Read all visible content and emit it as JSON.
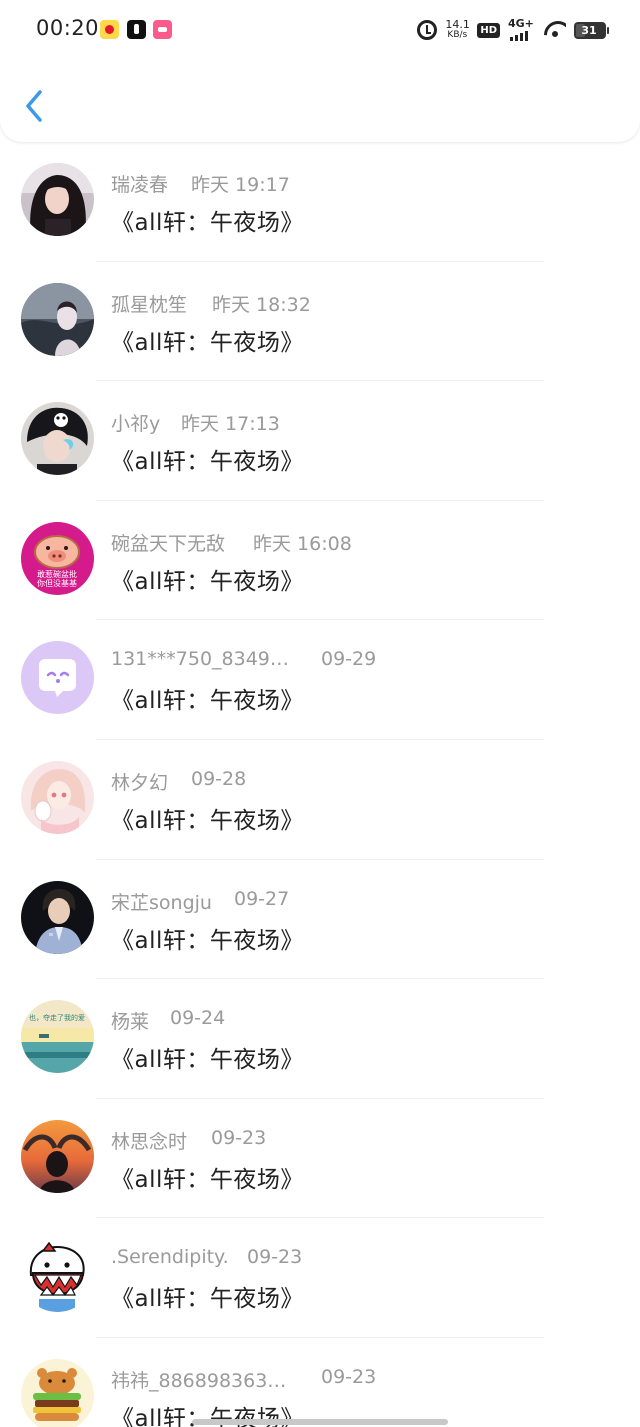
{
  "status_bar": {
    "time": "00:20",
    "speed_value": "14.1",
    "speed_unit": "KB/s",
    "hd": "HD",
    "network": "4G+",
    "battery": "31",
    "notification_icons": [
      "weibo-icon",
      "tiktok-icon",
      "lofter-icon"
    ]
  },
  "header": {
    "back_icon": "chevron-left-icon",
    "accent": "#3a9ae8"
  },
  "items": [
    {
      "name": "瑞凌春",
      "time": "昨天 19:17",
      "message": "《all轩：午夜场》"
    },
    {
      "name": "孤星枕笙",
      "time": "昨天 18:32",
      "message": "《all轩：午夜场》"
    },
    {
      "name": "小祁y",
      "time": "昨天 17:13",
      "message": "《all轩：午夜场》"
    },
    {
      "name": "碗盆天下无敌",
      "time": "昨天 16:08",
      "message": "《all轩：午夜场》"
    },
    {
      "name": "131***750_8349…",
      "time": "09-29",
      "message": "《all轩：午夜场》"
    },
    {
      "name": "林夕幻",
      "time": "09-28",
      "message": "《all轩：午夜场》"
    },
    {
      "name": "宋芷songju",
      "time": "09-27",
      "message": "《all轩：午夜场》"
    },
    {
      "name": "杨莱",
      "time": "09-24",
      "message": "《all轩：午夜场》"
    },
    {
      "name": "林思念时",
      "time": "09-23",
      "message": "《all轩：午夜场》"
    },
    {
      "name": ".Serendipity.",
      "time": "09-23",
      "message": "《all轩：午夜场》"
    },
    {
      "name": "祎祎_886898363…",
      "time": "09-23",
      "message": "《all轩：午夜场》"
    }
  ],
  "avatar_badges": {
    "bowl": "敢惹碗盆批\n你但没基基",
    "sea": "也，夺走了我的爱"
  }
}
